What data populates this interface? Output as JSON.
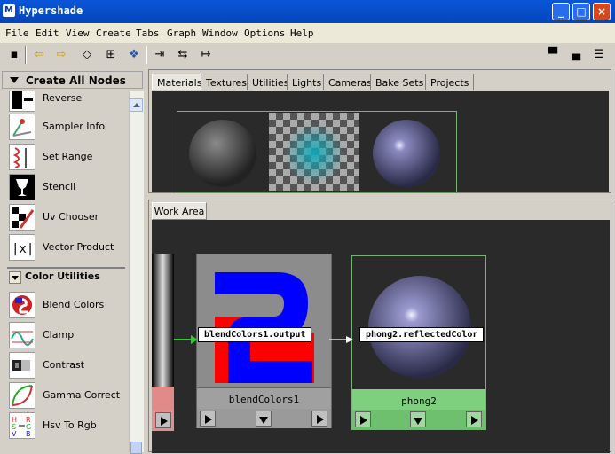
{
  "window": {
    "title": "Hypershade",
    "app_icon": "M"
  },
  "menu": [
    "File",
    "Edit",
    "View",
    "Create",
    "Tabs",
    "Graph",
    "Window",
    "Options",
    "Help"
  ],
  "left_panel": {
    "header": "Create All Nodes",
    "items": [
      {
        "label": "Reverse",
        "icon": "reverse-icon"
      },
      {
        "label": "Sampler Info",
        "icon": "sampler-info-icon"
      },
      {
        "label": "Set Range",
        "icon": "set-range-icon"
      },
      {
        "label": "Stencil",
        "icon": "stencil-icon"
      },
      {
        "label": "Uv Chooser",
        "icon": "uv-chooser-icon"
      },
      {
        "label": "Vector Product",
        "icon": "vector-product-icon"
      }
    ],
    "section": "Color Utilities",
    "color_items": [
      {
        "label": "Blend Colors",
        "icon": "blend-colors-icon"
      },
      {
        "label": "Clamp",
        "icon": "clamp-icon"
      },
      {
        "label": "Contrast",
        "icon": "contrast-icon"
      },
      {
        "label": "Gamma Correct",
        "icon": "gamma-correct-icon"
      },
      {
        "label": "Hsv To Rgb",
        "icon": "hsv-to-rgb-icon"
      }
    ]
  },
  "top_tabs": [
    "Materials",
    "Textures",
    "Utilities",
    "Lights",
    "Cameras",
    "Bake Sets",
    "Projects"
  ],
  "work_area": {
    "tab": "Work Area",
    "node_blend": "blendColors1",
    "node_phong": "phong2",
    "conn_out": "blendColors1.output",
    "conn_in": "phong2.reflectedColor"
  }
}
